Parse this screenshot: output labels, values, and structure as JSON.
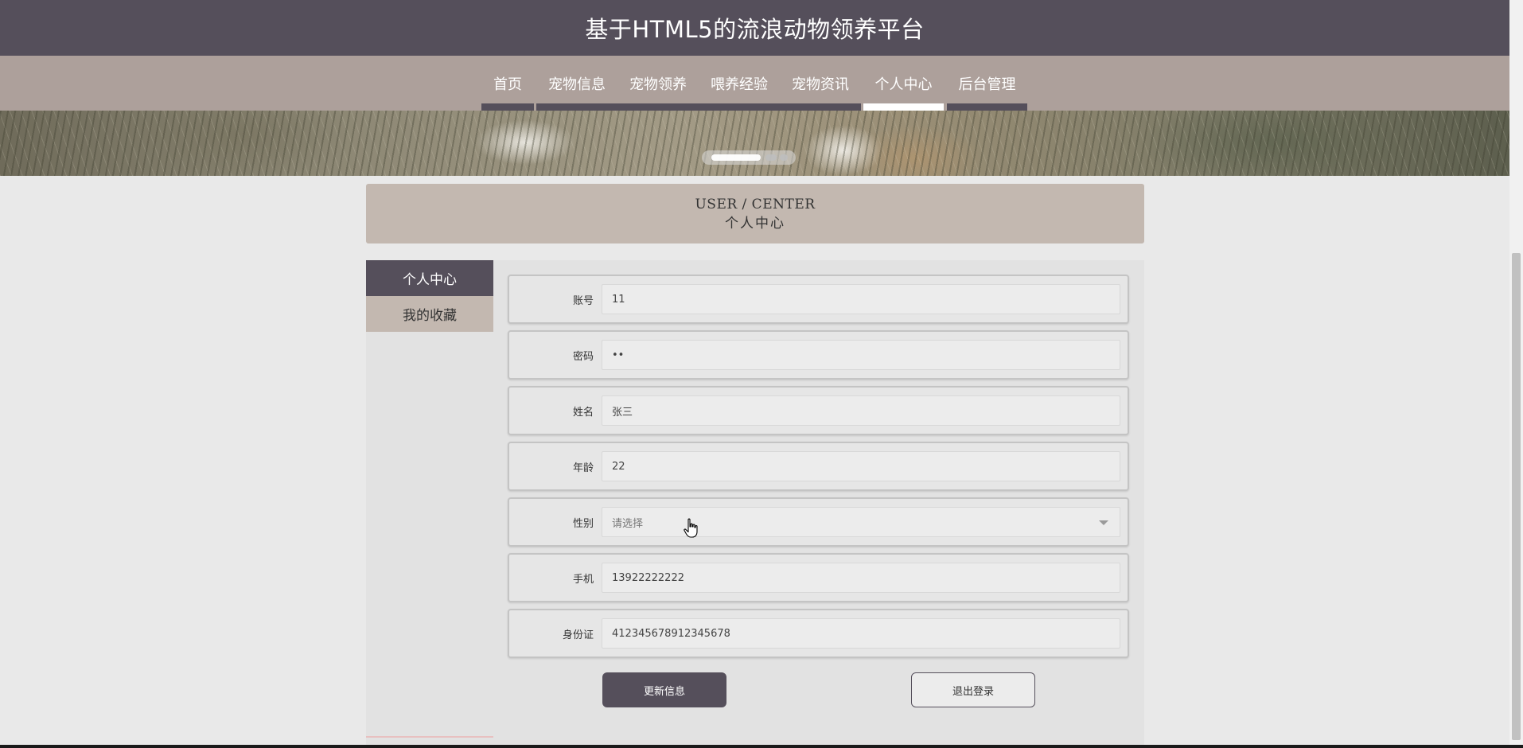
{
  "header": {
    "title": "基于HTML5的流浪动物领养平台"
  },
  "nav": {
    "items": [
      {
        "label": "首页",
        "active": false
      },
      {
        "label": "宠物信息",
        "active": false
      },
      {
        "label": "宠物领养",
        "active": false
      },
      {
        "label": "喂养经验",
        "active": false
      },
      {
        "label": "宠物资讯",
        "active": false
      },
      {
        "label": "个人中心",
        "active": true
      },
      {
        "label": "后台管理",
        "active": false
      }
    ]
  },
  "page_title": {
    "en": "USER / CENTER",
    "cn": "个人中心"
  },
  "sidebar": {
    "items": [
      {
        "label": "个人中心",
        "active": true
      },
      {
        "label": "我的收藏",
        "active": false
      }
    ]
  },
  "form": {
    "fields": [
      {
        "label": "账号",
        "value": "11"
      },
      {
        "label": "密码",
        "value": "••"
      },
      {
        "label": "姓名",
        "value": "张三"
      },
      {
        "label": "年龄",
        "value": "22"
      },
      {
        "label": "性别",
        "value": "",
        "placeholder": "请选择"
      },
      {
        "label": "手机",
        "value": "13922222222"
      },
      {
        "label": "身份证",
        "value": "412345678912345678"
      }
    ]
  },
  "buttons": {
    "update": "更新信息",
    "logout": "退出登录"
  },
  "colors": {
    "header_bg": "#554f5b",
    "nav_bg": "#ada09b",
    "title_box_bg": "#c3b8b0",
    "panel_bg": "#e2e2e2",
    "accent": "#554f5b"
  }
}
